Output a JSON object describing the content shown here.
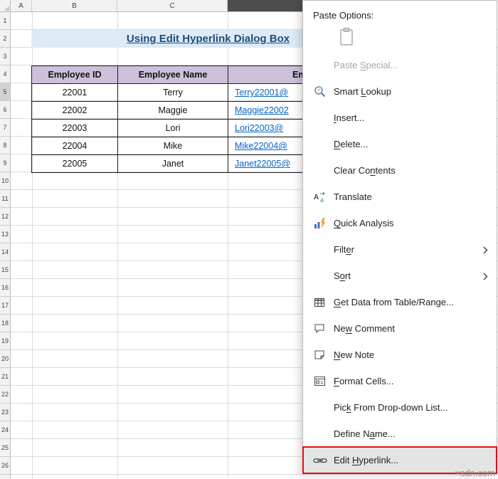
{
  "sheet": {
    "col_headers": [
      "A",
      "B",
      "C"
    ],
    "row_headers": [
      "1",
      "2",
      "3",
      "4",
      "5",
      "6",
      "7",
      "8",
      "9",
      "10",
      "11",
      "12",
      "13",
      "14",
      "15",
      "16",
      "17",
      "18",
      "19",
      "20",
      "21",
      "22",
      "23",
      "24",
      "25",
      "26"
    ],
    "title": "Using Edit Hyperlink Dialog Box",
    "table": {
      "headers": [
        "Employee ID",
        "Employee Name",
        "Em"
      ],
      "rows": [
        {
          "id": "22001",
          "name": "Terry",
          "email": "Terry22001@"
        },
        {
          "id": "22002",
          "name": "Maggie",
          "email": "Maggie22002"
        },
        {
          "id": "22003",
          "name": "Lori",
          "email": "Lori22003@"
        },
        {
          "id": "22004",
          "name": "Mike",
          "email": "Mike22004@"
        },
        {
          "id": "22005",
          "name": "Janet",
          "email": "Janet22005@"
        }
      ]
    }
  },
  "menu": {
    "paste_options_label": "Paste Options:",
    "items": [
      {
        "name": "paste-special",
        "icon": "",
        "pre": "Paste ",
        "key": "S",
        "post": "pecial...",
        "disabled": true
      },
      {
        "name": "smart-lookup",
        "icon": "smart-lookup-icon",
        "pre": "Smart ",
        "key": "L",
        "post": "ookup"
      },
      {
        "name": "insert",
        "icon": "",
        "pre": "",
        "key": "I",
        "post": "nsert..."
      },
      {
        "name": "delete",
        "icon": "",
        "pre": "",
        "key": "D",
        "post": "elete..."
      },
      {
        "name": "clear-contents",
        "icon": "",
        "pre": "Clear Co",
        "key": "n",
        "post": "tents"
      },
      {
        "name": "translate",
        "icon": "translate-icon",
        "pre": "Translate",
        "key": "",
        "post": ""
      },
      {
        "name": "quick-analysis",
        "icon": "quick-analysis-icon",
        "pre": "",
        "key": "Q",
        "post": "uick Analysis"
      },
      {
        "name": "filter",
        "icon": "",
        "pre": "Filt",
        "key": "e",
        "post": "r",
        "submenu": true
      },
      {
        "name": "sort",
        "icon": "",
        "pre": "S",
        "key": "o",
        "post": "rt",
        "submenu": true
      },
      {
        "name": "get-data",
        "icon": "get-data-icon",
        "pre": "",
        "key": "G",
        "post": "et Data from Table/Range..."
      },
      {
        "name": "new-comment",
        "icon": "new-comment-icon",
        "pre": "Ne",
        "key": "w",
        "post": " Comment"
      },
      {
        "name": "new-note",
        "icon": "new-note-icon",
        "pre": "",
        "key": "N",
        "post": "ew Note"
      },
      {
        "name": "format-cells",
        "icon": "format-cells-icon",
        "pre": "",
        "key": "F",
        "post": "ormat Cells..."
      },
      {
        "name": "pick-from-list",
        "icon": "",
        "pre": "Pic",
        "key": "k",
        "post": " From Drop-down List..."
      },
      {
        "name": "define-name",
        "icon": "",
        "pre": "Define N",
        "key": "a",
        "post": "me..."
      },
      {
        "name": "edit-hyperlink",
        "icon": "edit-hyperlink-icon",
        "pre": "Edit ",
        "key": "H",
        "post": "yperlink...",
        "highlighted": true
      }
    ]
  },
  "watermark": "×sdn.com",
  "colors": {
    "title_text": "#1F4E78",
    "title_fill": "#DDEBF7",
    "table_header_fill": "#CCC0DA",
    "hyperlink": "#0563C1",
    "annotation_red": "#E01212",
    "selected_column_header": "#4D4D4D"
  }
}
